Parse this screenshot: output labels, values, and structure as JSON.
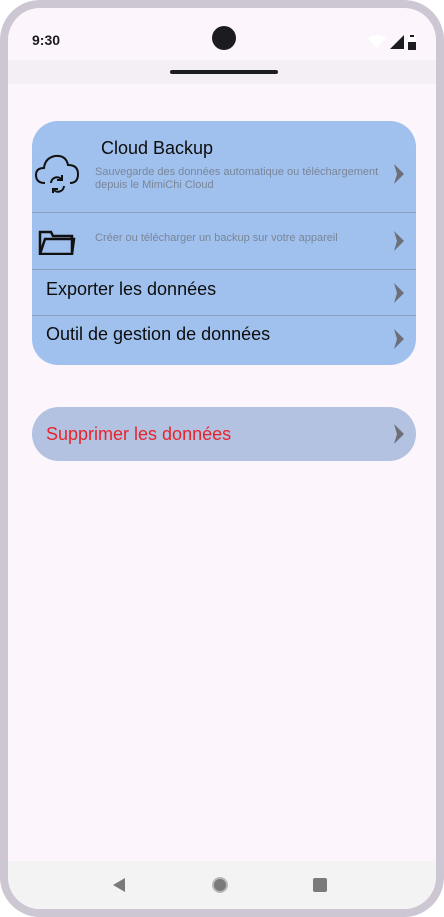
{
  "status_bar": {
    "time": "9:30",
    "icons": [
      "wifi-icon",
      "signal-icon",
      "battery-icon"
    ]
  },
  "data_card": {
    "items": [
      {
        "title": "Cloud Backup",
        "subtitle": "Sauvegarde des données automatique ou téléchargement depuis le MimiChi Cloud",
        "icon": "cloud-sync-icon"
      },
      {
        "title": "",
        "subtitle": "Créer ou télécharger un backup sur votre appareil",
        "icon": "folder-icon"
      },
      {
        "title": "Exporter les données"
      },
      {
        "title": "Outil de gestion de données"
      }
    ]
  },
  "delete_card": {
    "label": "Supprimer les données"
  },
  "colors": {
    "card_bg": "#a0c1ee",
    "delete_bg": "#b4c2e1",
    "delete_text": "#e8232b",
    "screen_bg": "#fcf6fc"
  }
}
